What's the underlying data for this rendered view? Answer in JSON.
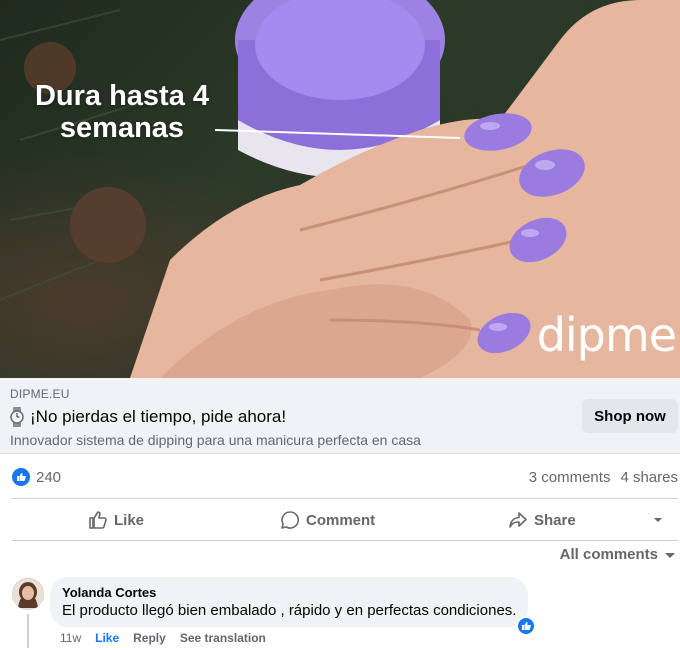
{
  "ad": {
    "overlay_text_line1": "Dura hasta 4",
    "overlay_text_line2": "semanas",
    "brand_logo": "dipme",
    "accent_color": "#9c7ee0"
  },
  "link_preview": {
    "domain": "DIPME.EU",
    "title_icon": "watch-icon",
    "title": "¡No pierdas el tiempo, pide ahora!",
    "description": "Innovador sistema de dipping para una manicura perfecta en casa",
    "cta_label": "Shop now"
  },
  "reactions": {
    "like_count": "240",
    "comments": "3 comments",
    "shares": "4 shares"
  },
  "actions": {
    "like": "Like",
    "comment": "Comment",
    "share": "Share"
  },
  "comments_filter": "All comments",
  "comment": {
    "author": "Yolanda Cortes",
    "text": "El producto llegó bien embalado , rápido y en perfectas condiciones.",
    "age": "11w",
    "like_label": "Like",
    "reply_label": "Reply",
    "translate_label": "See translation"
  },
  "colors": {
    "facebook_blue": "#1877f2",
    "secondary_text": "#65676b",
    "panel_bg": "#f0f2f5"
  }
}
